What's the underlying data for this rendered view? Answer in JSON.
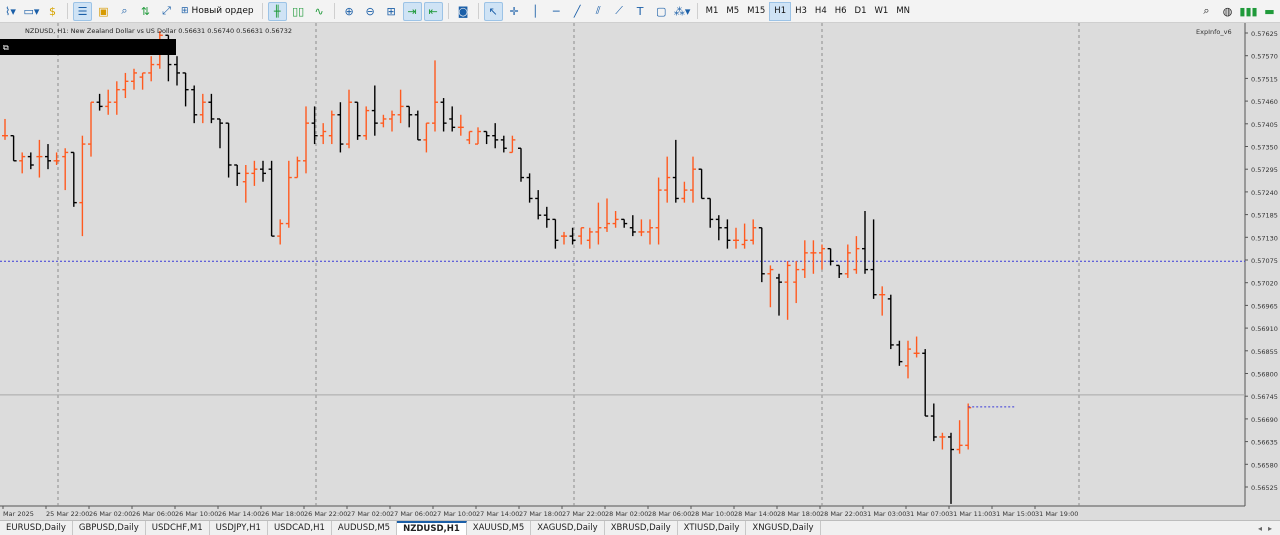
{
  "toolbar": {
    "new_order_label": "Новый ордер",
    "timeframes": [
      "M1",
      "M5",
      "M15",
      "H1",
      "H3",
      "H4",
      "H6",
      "D1",
      "W1",
      "MN"
    ],
    "active_timeframe": "H1"
  },
  "chart": {
    "info_line": "NZDUSD, H1:  New Zealand Dollar vs US Dollar  0.56631 0.56740 0.56631 0.56732",
    "indicator_label": "ExpInfo_v6",
    "bull_color": "#ff5a1f",
    "bear_color": "#000000",
    "bid_line_color": "#3a3ad8",
    "price_ticks": [
      "0.57625",
      "0.57570",
      "0.57515",
      "0.57460",
      "0.57405",
      "0.57350",
      "0.57295",
      "0.57240",
      "0.57185",
      "0.57130",
      "0.57075",
      "0.57020",
      "0.56965",
      "0.56910",
      "0.56855",
      "0.56800",
      "0.56745",
      "0.56690",
      "0.56635",
      "0.56580",
      "0.56525"
    ],
    "time_ticks": [
      "Mar 2025",
      "25 Mar 22:00",
      "26 Mar 02:00",
      "26 Mar 06:00",
      "26 Mar 10:00",
      "26 Mar 14:00",
      "26 Mar 18:00",
      "26 Mar 22:00",
      "27 Mar 02:00",
      "27 Mar 06:00",
      "27 Mar 10:00",
      "27 Mar 14:00",
      "27 Mar 18:00",
      "27 Mar 22:00",
      "28 Mar 02:00",
      "28 Mar 06:00",
      "28 Mar 10:00",
      "28 Mar 14:00",
      "28 Mar 18:00",
      "28 Mar 22:00",
      "31 Mar 03:00",
      "31 Mar 07:00",
      "31 Mar 11:00",
      "31 Mar 15:00",
      "31 Mar 19:00"
    ]
  },
  "chart_data": {
    "type": "ohlc",
    "symbol": "NZDUSD",
    "timeframe": "H1",
    "ylim": [
      0.56495,
      0.57635
    ],
    "bid_price": 0.5708,
    "current_price": 0.56732,
    "bars": [
      {
        "o": 0.5738,
        "h": 0.5742,
        "l": 0.5737,
        "c": 0.5738
      },
      {
        "o": 0.5738,
        "h": 0.5738,
        "l": 0.5732,
        "c": 0.5732
      },
      {
        "o": 0.5732,
        "h": 0.5734,
        "l": 0.5729,
        "c": 0.5733
      },
      {
        "o": 0.5733,
        "h": 0.5734,
        "l": 0.573,
        "c": 0.5731
      },
      {
        "o": 0.5733,
        "h": 0.5737,
        "l": 0.5728,
        "c": 0.5733
      },
      {
        "o": 0.5733,
        "h": 0.5736,
        "l": 0.573,
        "c": 0.5732
      },
      {
        "o": 0.5732,
        "h": 0.5734,
        "l": 0.5731,
        "c": 0.5732
      },
      {
        "o": 0.5733,
        "h": 0.5735,
        "l": 0.5725,
        "c": 0.5734
      },
      {
        "o": 0.5734,
        "h": 0.5734,
        "l": 0.5721,
        "c": 0.5722
      },
      {
        "o": 0.5722,
        "h": 0.5738,
        "l": 0.5714,
        "c": 0.5736
      },
      {
        "o": 0.5736,
        "h": 0.5746,
        "l": 0.5733,
        "c": 0.5746
      },
      {
        "o": 0.5746,
        "h": 0.5748,
        "l": 0.5744,
        "c": 0.5745
      },
      {
        "o": 0.5745,
        "h": 0.5749,
        "l": 0.5743,
        "c": 0.5746
      },
      {
        "o": 0.5746,
        "h": 0.5751,
        "l": 0.5743,
        "c": 0.5749
      },
      {
        "o": 0.5749,
        "h": 0.5753,
        "l": 0.5747,
        "c": 0.5751
      },
      {
        "o": 0.5751,
        "h": 0.5754,
        "l": 0.5749,
        "c": 0.5753
      },
      {
        "o": 0.5752,
        "h": 0.5753,
        "l": 0.5749,
        "c": 0.5753
      },
      {
        "o": 0.5753,
        "h": 0.5757,
        "l": 0.5751,
        "c": 0.5755
      },
      {
        "o": 0.5755,
        "h": 0.5763,
        "l": 0.5754,
        "c": 0.5762
      },
      {
        "o": 0.5762,
        "h": 0.5762,
        "l": 0.5751,
        "c": 0.5755
      },
      {
        "o": 0.5755,
        "h": 0.5757,
        "l": 0.575,
        "c": 0.5753
      },
      {
        "o": 0.5753,
        "h": 0.5753,
        "l": 0.5745,
        "c": 0.5749
      },
      {
        "o": 0.5749,
        "h": 0.575,
        "l": 0.5741,
        "c": 0.5743
      },
      {
        "o": 0.5743,
        "h": 0.5748,
        "l": 0.5741,
        "c": 0.5746
      },
      {
        "o": 0.5746,
        "h": 0.5748,
        "l": 0.5741,
        "c": 0.5742
      },
      {
        "o": 0.5742,
        "h": 0.5742,
        "l": 0.5735,
        "c": 0.5741
      },
      {
        "o": 0.5741,
        "h": 0.5741,
        "l": 0.5728,
        "c": 0.5731
      },
      {
        "o": 0.5731,
        "h": 0.5731,
        "l": 0.5726,
        "c": 0.5729
      },
      {
        "o": 0.5727,
        "h": 0.5731,
        "l": 0.5722,
        "c": 0.5729
      },
      {
        "o": 0.5729,
        "h": 0.5732,
        "l": 0.5726,
        "c": 0.573
      },
      {
        "o": 0.573,
        "h": 0.5732,
        "l": 0.5727,
        "c": 0.5729
      },
      {
        "o": 0.573,
        "h": 0.5732,
        "l": 0.5714,
        "c": 0.5714
      },
      {
        "o": 0.5714,
        "h": 0.5718,
        "l": 0.5712,
        "c": 0.5717
      },
      {
        "o": 0.5717,
        "h": 0.5732,
        "l": 0.5716,
        "c": 0.5728
      },
      {
        "o": 0.5728,
        "h": 0.5733,
        "l": 0.5728,
        "c": 0.5732
      },
      {
        "o": 0.5732,
        "h": 0.5745,
        "l": 0.5729,
        "c": 0.5741
      },
      {
        "o": 0.5741,
        "h": 0.5745,
        "l": 0.5736,
        "c": 0.5738
      },
      {
        "o": 0.5738,
        "h": 0.5741,
        "l": 0.5736,
        "c": 0.5739
      },
      {
        "o": 0.5738,
        "h": 0.5744,
        "l": 0.5736,
        "c": 0.5743
      },
      {
        "o": 0.5743,
        "h": 0.5746,
        "l": 0.5734,
        "c": 0.5736
      },
      {
        "o": 0.5736,
        "h": 0.5749,
        "l": 0.5735,
        "c": 0.5746
      },
      {
        "o": 0.5746,
        "h": 0.5746,
        "l": 0.5737,
        "c": 0.5738
      },
      {
        "o": 0.5738,
        "h": 0.5745,
        "l": 0.5737,
        "c": 0.5744
      },
      {
        "o": 0.5744,
        "h": 0.575,
        "l": 0.5738,
        "c": 0.5741
      },
      {
        "o": 0.5741,
        "h": 0.5743,
        "l": 0.574,
        "c": 0.5742
      },
      {
        "o": 0.5742,
        "h": 0.5744,
        "l": 0.5739,
        "c": 0.5743
      },
      {
        "o": 0.5743,
        "h": 0.5749,
        "l": 0.5741,
        "c": 0.5745
      },
      {
        "o": 0.5745,
        "h": 0.5745,
        "l": 0.574,
        "c": 0.5743
      },
      {
        "o": 0.5743,
        "h": 0.5744,
        "l": 0.5737,
        "c": 0.5737
      },
      {
        "o": 0.5737,
        "h": 0.5741,
        "l": 0.5734,
        "c": 0.5741
      },
      {
        "o": 0.5741,
        "h": 0.5756,
        "l": 0.5739,
        "c": 0.5746
      },
      {
        "o": 0.5746,
        "h": 0.5747,
        "l": 0.5739,
        "c": 0.5741
      },
      {
        "o": 0.5742,
        "h": 0.5745,
        "l": 0.5739,
        "c": 0.574
      },
      {
        "o": 0.574,
        "h": 0.5743,
        "l": 0.5738,
        "c": 0.574
      },
      {
        "o": 0.5737,
        "h": 0.5739,
        "l": 0.5736,
        "c": 0.5739
      },
      {
        "o": 0.5736,
        "h": 0.574,
        "l": 0.5736,
        "c": 0.5739
      },
      {
        "o": 0.5739,
        "h": 0.5739,
        "l": 0.5736,
        "c": 0.5738
      },
      {
        "o": 0.5738,
        "h": 0.5741,
        "l": 0.5735,
        "c": 0.5737
      },
      {
        "o": 0.5737,
        "h": 0.5738,
        "l": 0.5734,
        "c": 0.5735
      },
      {
        "o": 0.5734,
        "h": 0.5738,
        "l": 0.5734,
        "c": 0.5737
      },
      {
        "o": 0.5735,
        "h": 0.5735,
        "l": 0.5727,
        "c": 0.5728
      },
      {
        "o": 0.5728,
        "h": 0.5729,
        "l": 0.5722,
        "c": 0.5723
      },
      {
        "o": 0.5723,
        "h": 0.5725,
        "l": 0.5718,
        "c": 0.5719
      },
      {
        "o": 0.5719,
        "h": 0.5721,
        "l": 0.5716,
        "c": 0.5718
      },
      {
        "o": 0.5718,
        "h": 0.5718,
        "l": 0.5711,
        "c": 0.5713
      },
      {
        "o": 0.5714,
        "h": 0.5715,
        "l": 0.5712,
        "c": 0.5714
      },
      {
        "o": 0.5714,
        "h": 0.5716,
        "l": 0.5712,
        "c": 0.5713
      },
      {
        "o": 0.5714,
        "h": 0.5716,
        "l": 0.5712,
        "c": 0.5716
      },
      {
        "o": 0.5713,
        "h": 0.5716,
        "l": 0.5711,
        "c": 0.5715
      },
      {
        "o": 0.5715,
        "h": 0.5722,
        "l": 0.5712,
        "c": 0.5716
      },
      {
        "o": 0.5716,
        "h": 0.5723,
        "l": 0.5715,
        "c": 0.5717
      },
      {
        "o": 0.5717,
        "h": 0.572,
        "l": 0.5716,
        "c": 0.5718
      },
      {
        "o": 0.5718,
        "h": 0.5718,
        "l": 0.5716,
        "c": 0.5717
      },
      {
        "o": 0.5716,
        "h": 0.5719,
        "l": 0.5714,
        "c": 0.5715
      },
      {
        "o": 0.5715,
        "h": 0.5718,
        "l": 0.5714,
        "c": 0.5715
      },
      {
        "o": 0.5715,
        "h": 0.5718,
        "l": 0.5712,
        "c": 0.5716
      },
      {
        "o": 0.5716,
        "h": 0.5728,
        "l": 0.5712,
        "c": 0.5725
      },
      {
        "o": 0.5725,
        "h": 0.5733,
        "l": 0.5722,
        "c": 0.5728
      },
      {
        "o": 0.5728,
        "h": 0.5737,
        "l": 0.5722,
        "c": 0.5723
      },
      {
        "o": 0.5723,
        "h": 0.5727,
        "l": 0.5722,
        "c": 0.5725
      },
      {
        "o": 0.5725,
        "h": 0.5733,
        "l": 0.5722,
        "c": 0.573
      },
      {
        "o": 0.573,
        "h": 0.573,
        "l": 0.5723,
        "c": 0.5723
      },
      {
        "o": 0.5723,
        "h": 0.5723,
        "l": 0.5716,
        "c": 0.5718
      },
      {
        "o": 0.5718,
        "h": 0.5719,
        "l": 0.5713,
        "c": 0.5716
      },
      {
        "o": 0.5716,
        "h": 0.5718,
        "l": 0.5711,
        "c": 0.5713
      },
      {
        "o": 0.5713,
        "h": 0.5716,
        "l": 0.5711,
        "c": 0.5713
      },
      {
        "o": 0.5712,
        "h": 0.5717,
        "l": 0.5711,
        "c": 0.5713
      },
      {
        "o": 0.5713,
        "h": 0.5718,
        "l": 0.5712,
        "c": 0.5716
      },
      {
        "o": 0.5716,
        "h": 0.5716,
        "l": 0.5703,
        "c": 0.5705
      },
      {
        "o": 0.5705,
        "h": 0.5707,
        "l": 0.5697,
        "c": 0.5706
      },
      {
        "o": 0.5704,
        "h": 0.5705,
        "l": 0.5695,
        "c": 0.5703
      },
      {
        "o": 0.5703,
        "h": 0.5708,
        "l": 0.5694,
        "c": 0.5707
      },
      {
        "o": 0.5703,
        "h": 0.5708,
        "l": 0.5698,
        "c": 0.5706
      },
      {
        "o": 0.5706,
        "h": 0.5713,
        "l": 0.5704,
        "c": 0.571
      },
      {
        "o": 0.571,
        "h": 0.5713,
        "l": 0.5705,
        "c": 0.571
      },
      {
        "o": 0.571,
        "h": 0.5712,
        "l": 0.5706,
        "c": 0.5711
      },
      {
        "o": 0.5711,
        "h": 0.5711,
        "l": 0.5707,
        "c": 0.5708
      },
      {
        "o": 0.5707,
        "h": 0.5707,
        "l": 0.5704,
        "c": 0.5705
      },
      {
        "o": 0.5705,
        "h": 0.5712,
        "l": 0.5704,
        "c": 0.571
      },
      {
        "o": 0.5706,
        "h": 0.5714,
        "l": 0.5705,
        "c": 0.5711
      },
      {
        "o": 0.5711,
        "h": 0.572,
        "l": 0.5705,
        "c": 0.5706
      },
      {
        "o": 0.5706,
        "h": 0.5718,
        "l": 0.5699,
        "c": 0.57
      },
      {
        "o": 0.57,
        "h": 0.5702,
        "l": 0.5695,
        "c": 0.57
      },
      {
        "o": 0.5699,
        "h": 0.57,
        "l": 0.5687,
        "c": 0.5688
      },
      {
        "o": 0.5688,
        "h": 0.5689,
        "l": 0.5683,
        "c": 0.5684
      },
      {
        "o": 0.5683,
        "h": 0.5689,
        "l": 0.568,
        "c": 0.5687
      },
      {
        "o": 0.5686,
        "h": 0.569,
        "l": 0.5685,
        "c": 0.5686
      },
      {
        "o": 0.5686,
        "h": 0.5687,
        "l": 0.5671,
        "c": 0.5671
      },
      {
        "o": 0.5671,
        "h": 0.5674,
        "l": 0.5665,
        "c": 0.5666
      },
      {
        "o": 0.5666,
        "h": 0.5667,
        "l": 0.5663,
        "c": 0.5666
      },
      {
        "o": 0.5666,
        "h": 0.5667,
        "l": 0.565,
        "c": 0.5663
      },
      {
        "o": 0.5663,
        "h": 0.567,
        "l": 0.5662,
        "c": 0.5664
      },
      {
        "o": 0.5664,
        "h": 0.5674,
        "l": 0.5663,
        "c": 0.5673
      }
    ]
  },
  "tabs": [
    {
      "label": "EURUSD,Daily",
      "active": false
    },
    {
      "label": "GBPUSD,Daily",
      "active": false
    },
    {
      "label": "USDCHF,M1",
      "active": false
    },
    {
      "label": "USDJPY,H1",
      "active": false
    },
    {
      "label": "USDCAD,H1",
      "active": false
    },
    {
      "label": "AUDUSD,M5",
      "active": false
    },
    {
      "label": "NZDUSD,H1",
      "active": true
    },
    {
      "label": "XAUUSD,M5",
      "active": false
    },
    {
      "label": "XAGUSD,Daily",
      "active": false
    },
    {
      "label": "XBRUSD,Daily",
      "active": false
    },
    {
      "label": "XTIUSD,Daily",
      "active": false
    },
    {
      "label": "XNGUSD,Daily",
      "active": false
    }
  ]
}
